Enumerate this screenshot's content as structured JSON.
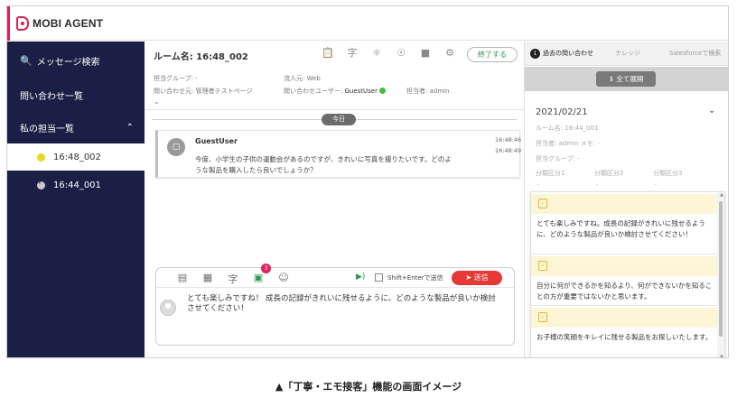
{
  "app": {
    "name": "MOBI AGENT"
  },
  "sidebar": {
    "search_label": "メッセージ検索",
    "inquiry_list_label": "問い合わせ一覧",
    "my_assignments_label": "私の担当一覧",
    "rooms": [
      {
        "label": "16:48_002",
        "status": "active"
      },
      {
        "label": "16:44_001",
        "status": "done"
      }
    ]
  },
  "chat_header": {
    "room_name": "ルーム名: 16:48_002",
    "end_button": "終了する",
    "assignee_group": "担当グループ: -",
    "source": "流入元: Web",
    "inquiry_origin": "問い合わせ元: 管理者テストページ",
    "inquiry_user_label": "問い合わせユーザー:",
    "inquiry_user": "GuestUser",
    "assignee": "担当者: admin"
  },
  "chat": {
    "day_badge": "今日",
    "message": {
      "user": "GuestUser",
      "text": "今度、小学生の子供の運動会があるのですが、きれいに写真を撮りたいです。どのような製品を購入したら良いでしょうか？",
      "time1": "16:48:46",
      "time2": "16:48:49"
    }
  },
  "composer": {
    "badge_count": "3",
    "shift_enter_label": "Shift+Enterで送信",
    "send_button": "送信",
    "text": "とても楽しみですね！ 成長の記録がきれいに残せるように、どのような製品が良いか検討させてください！"
  },
  "right_panel": {
    "tabs": {
      "history_count": "1",
      "history": "過去の問い合わせ",
      "knowledge": "ナレッジ",
      "salesforce": "Salesforceで検索"
    },
    "expand_all": "全て展開",
    "history": {
      "date": "2021/02/21",
      "room": "ルーム名: 16:44_001",
      "assignee_memo": "担当者: admin  メモ: -",
      "group": "担当グループ: -",
      "category1": "分類区分1",
      "category2": "分類区分2",
      "category3": "分類区分3",
      "dash": "-"
    },
    "suggestions": [
      "とても楽しみですね。成長の記録がきれいに残せるように、どのような製品が良いか検討させてください！",
      "自分に何ができるかを知るより、何ができないかを知ることの方が重要ではないかと思います。",
      "お子様の笑顔をキレイに残せる製品をお探しいたします。"
    ]
  },
  "caption": "▲「丁寧・エモ接客」機能の画面イメージ",
  "colors": {
    "sidebar_bg": "#1c1f45",
    "brand": "#d8245a",
    "send": "#e53935",
    "active_dot": "#e9d91c"
  },
  "icons": {
    "header": [
      "clipboard-icon",
      "translate-icon",
      "robot-icon",
      "lightbulb-icon",
      "contact-card-icon",
      "gear-icon"
    ],
    "composer": [
      "template-icon",
      "window-icon",
      "translate-icon",
      "ticket-icon",
      "emoji-icon"
    ]
  }
}
